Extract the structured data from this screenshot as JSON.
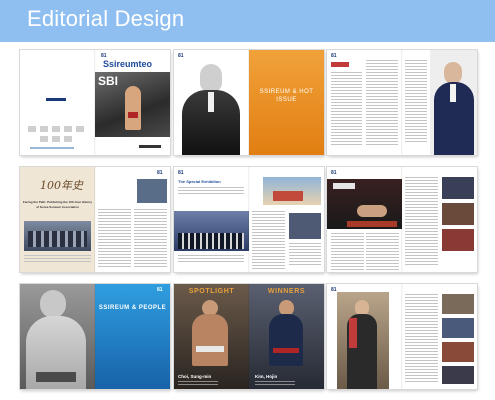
{
  "header": {
    "title": "Editorial Design",
    "background": "#8fbff0"
  },
  "spreads": {
    "s1": {
      "page_mark": "81",
      "logo": "Ssireumteo",
      "photo_text": "SBI"
    },
    "s2": {
      "page_mark": "81",
      "title": "SSIREUM & HOT ISSUE"
    },
    "s3": {
      "page_mark": "81"
    },
    "s4": {
      "page_mark": "81",
      "title": "Facing the Path: Publishing the 100-Year History of Korea Ssireum Association"
    },
    "s5": {
      "page_mark": "81",
      "title": "The Special Exhibition"
    },
    "s6": {
      "page_mark": "81"
    },
    "s7": {
      "page_mark": "81",
      "title": "SSIREUM & PEOPLE"
    },
    "s8": {
      "page_mark": "81",
      "heading_left": "SPOTLIGHT",
      "heading_right": "WINNERS",
      "name_left": "Choi, Sung-min",
      "name_right": "Kim, Hojin"
    },
    "s9": {
      "page_mark": "81"
    }
  },
  "colors": {
    "orange": "#e8931e",
    "blue": "#1e7fc4",
    "red": "#c23b3b"
  }
}
